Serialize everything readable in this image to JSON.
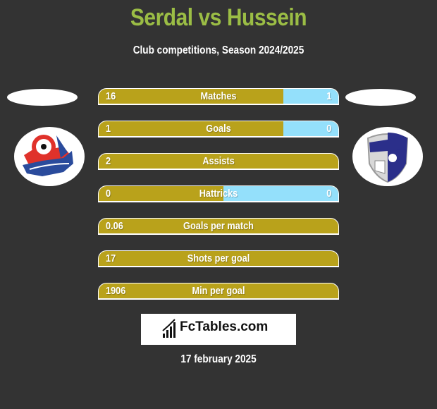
{
  "header": {
    "title": "Serdal vs Hussein",
    "subtitle": "Club competitions, Season 2024/2025"
  },
  "teams": {
    "left": {
      "logo": "hapoel-haifa-crest"
    },
    "right": {
      "logo": "hapoel-kiryat-shmona-crest"
    }
  },
  "colors": {
    "title": "#9bbd45",
    "left_bar": "#b9a21b",
    "right_bar": "#94e0fb",
    "background": "#333333"
  },
  "stats": [
    {
      "label": "Matches",
      "left": "16",
      "right": "1",
      "right_share": 0.23
    },
    {
      "label": "Goals",
      "left": "1",
      "right": "0",
      "right_share": 0.23
    },
    {
      "label": "Assists",
      "left": "2",
      "right": "",
      "right_share": 0
    },
    {
      "label": "Hattricks",
      "left": "0",
      "right": "0",
      "right_share": 0.48
    },
    {
      "label": "Goals per match",
      "left": "0.06",
      "right": "",
      "right_share": 0
    },
    {
      "label": "Shots per goal",
      "left": "17",
      "right": "",
      "right_share": 0
    },
    {
      "label": "Min per goal",
      "left": "1906",
      "right": "",
      "right_share": 0
    }
  ],
  "footer": {
    "brand": "FcTables.com",
    "date": "17 february 2025"
  }
}
